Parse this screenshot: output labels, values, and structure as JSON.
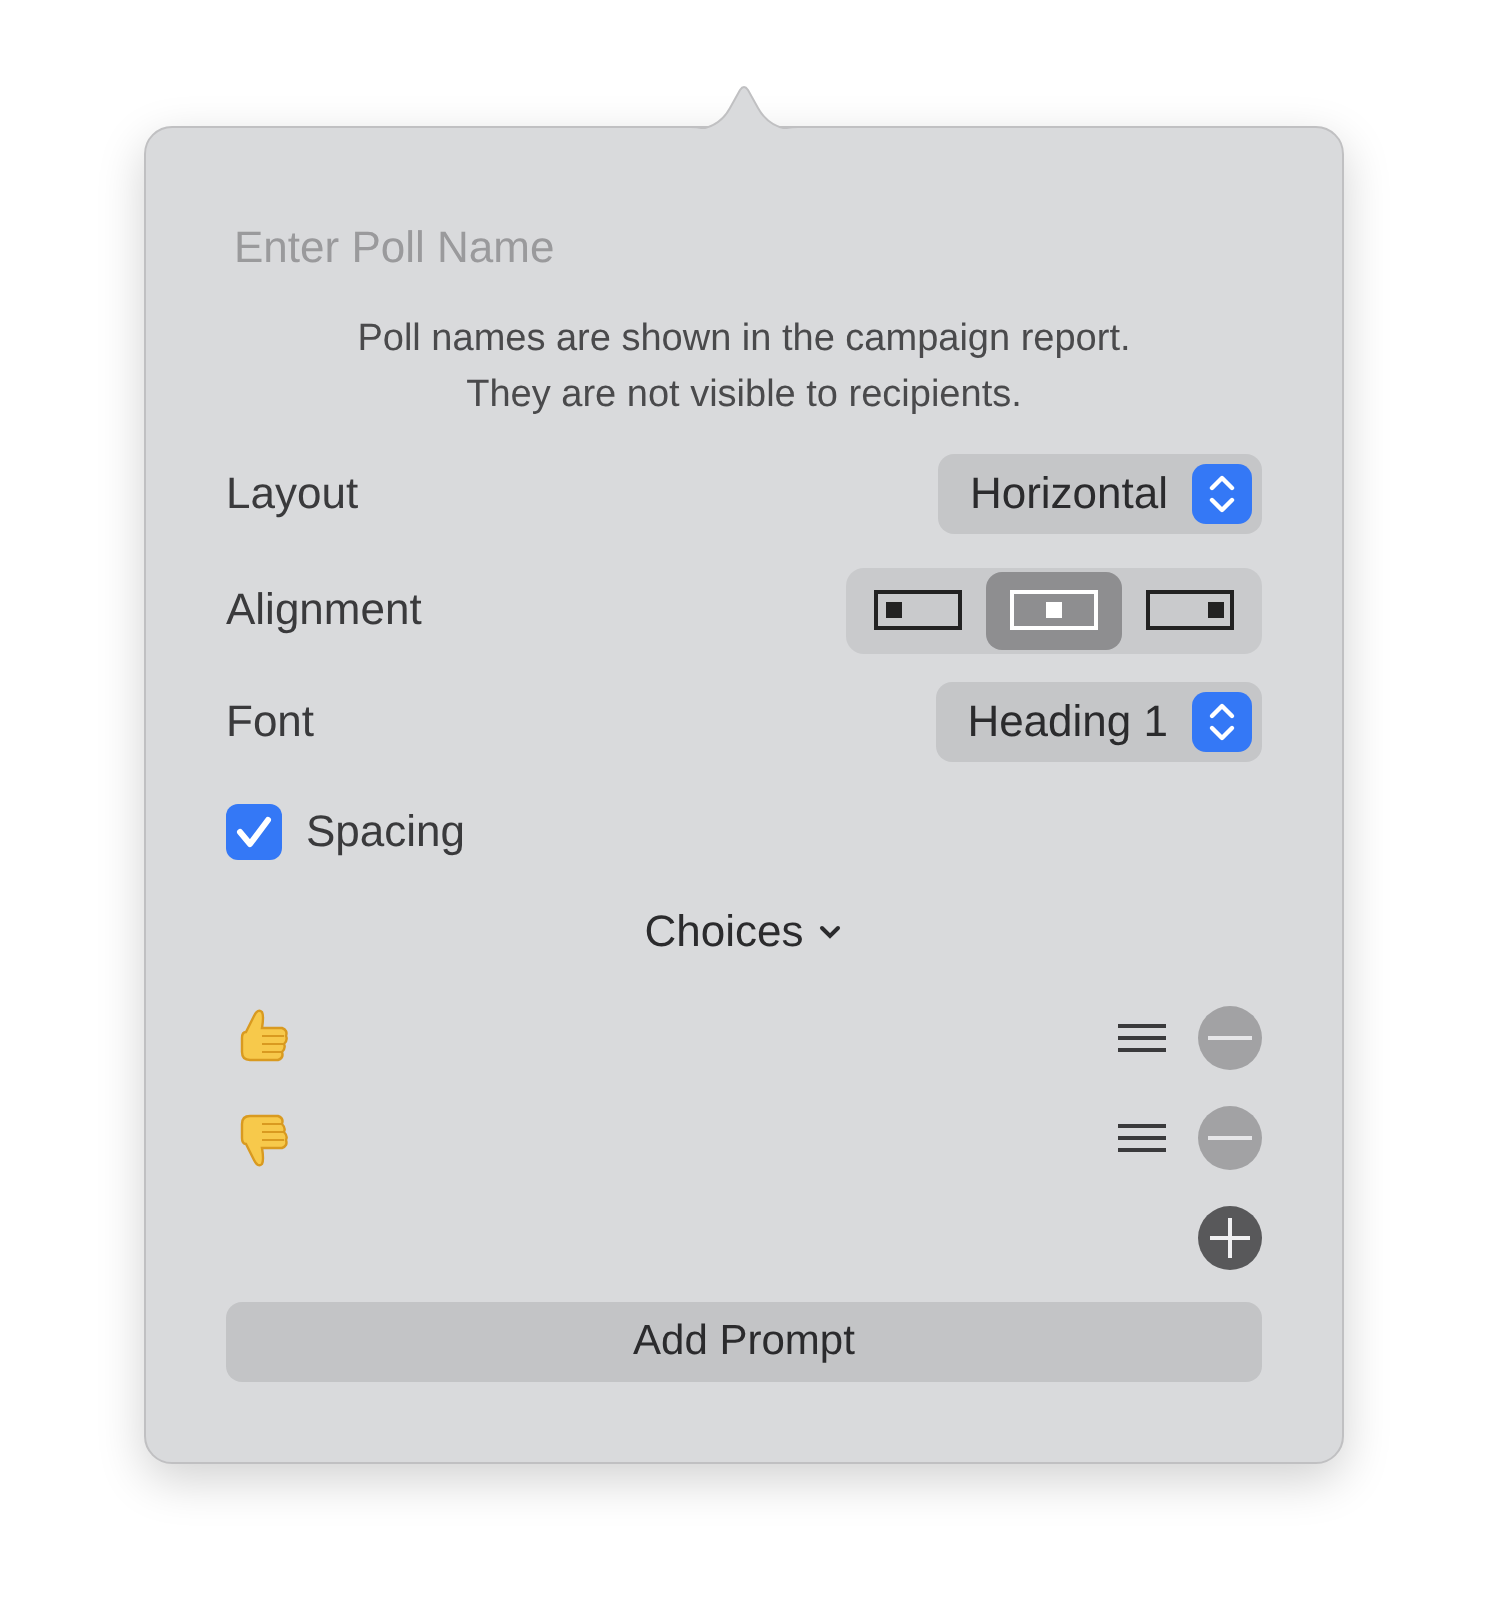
{
  "poll_name": {
    "placeholder": "Enter Poll Name"
  },
  "help_text": [
    "Poll names are shown in the campaign report.",
    "They are not visible to recipients."
  ],
  "layout": {
    "label": "Layout",
    "value": "Horizontal"
  },
  "alignment": {
    "label": "Alignment",
    "options": [
      {
        "kind": "left",
        "selected": false
      },
      {
        "kind": "center",
        "selected": true
      },
      {
        "kind": "right",
        "selected": false
      }
    ]
  },
  "font": {
    "label": "Font",
    "value": "Heading 1"
  },
  "spacing": {
    "label": "Spacing",
    "checked": true
  },
  "choices": {
    "label": "Choices",
    "expanded": true,
    "items": [
      {
        "kind": "thumbs_up"
      },
      {
        "kind": "thumbs_down"
      }
    ]
  },
  "add_prompt": "Add Prompt"
}
